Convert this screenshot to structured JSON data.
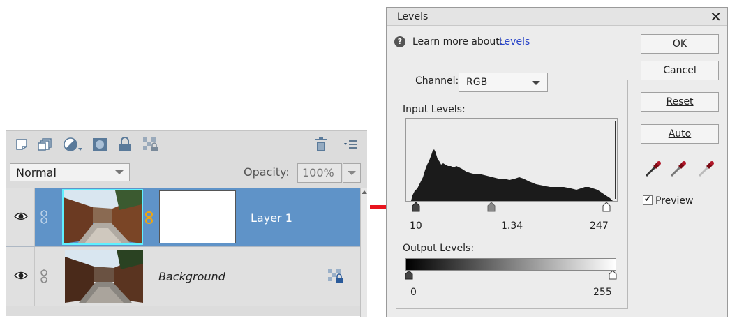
{
  "layers_panel": {
    "toolbar_icons": [
      "new-layer-icon",
      "new-group-icon",
      "adjustment-layer-icon",
      "layer-mask-icon",
      "lock-all-icon",
      "lock-transparency-icon",
      "delete-layer-icon",
      "panel-menu-icon"
    ],
    "blend_mode": "Normal",
    "opacity_label": "Opacity:",
    "opacity_value": "100%",
    "layers": [
      {
        "name": "Layer 1",
        "selected": true,
        "has_mask": true
      },
      {
        "name": "Background",
        "selected": false,
        "locked": true
      }
    ]
  },
  "levels_dialog": {
    "title": "Levels",
    "close": "✕",
    "learn_more": "Learn more about:",
    "learn_link": "Levels",
    "buttons": {
      "ok": "OK",
      "cancel": "Cancel",
      "reset": "Reset",
      "auto": "Auto"
    },
    "channel_label": "Channel:",
    "channel_value": "RGB",
    "input_levels_label": "Input Levels:",
    "input_values": {
      "black": "10",
      "gamma": "1.34",
      "white": "247"
    },
    "output_levels_label": "Output Levels:",
    "output_values": {
      "black": "0",
      "white": "255"
    },
    "preview_label": "Preview",
    "preview_checked": true,
    "eyedroppers": [
      "black-eyedropper-icon",
      "gray-eyedropper-icon",
      "white-eyedropper-icon"
    ]
  },
  "colors": {
    "selection": "#5f93c8",
    "annotation_arrow": "#e8141e",
    "link": "#2844c8"
  }
}
